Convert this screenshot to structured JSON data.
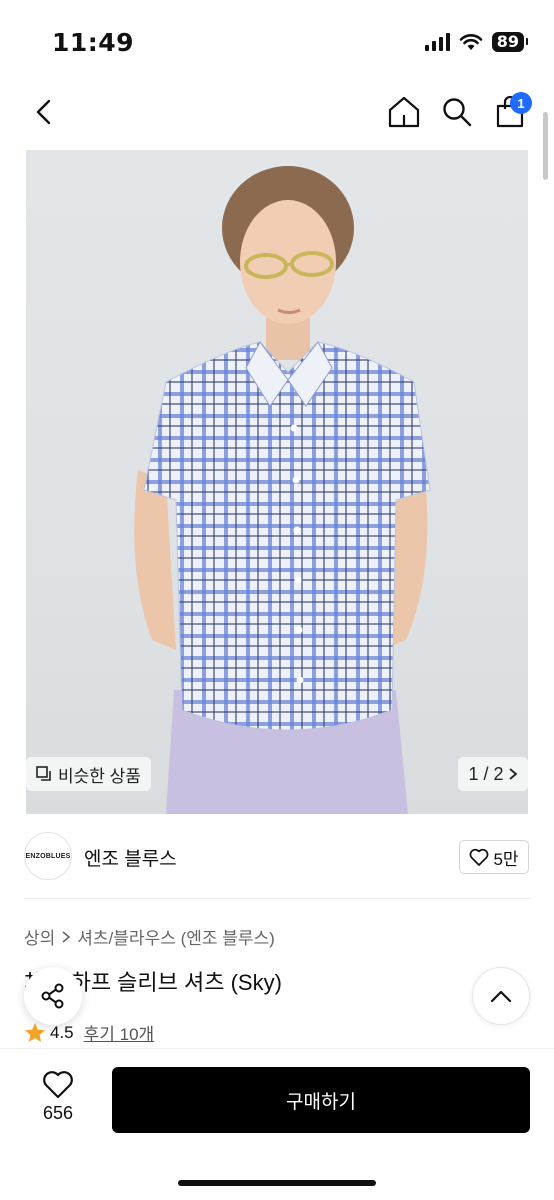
{
  "status_bar": {
    "time": "11:49",
    "battery_level": "89",
    "icons": [
      "signal-icon",
      "wifi-icon",
      "battery-icon"
    ]
  },
  "nav": {
    "icons": [
      "back-icon",
      "home-icon",
      "search-icon",
      "shopping-bag-icon"
    ],
    "cart_badge": "1",
    "badge_color": "#1f6bff"
  },
  "gallery": {
    "similar_label": "비슷한 상품",
    "page_current": "1",
    "page_total": "2",
    "page_indicator": "1 / 2"
  },
  "brand": {
    "logo_text": "ENZOBLUES",
    "name": "엔조 블루스",
    "like_count": "5만"
  },
  "breadcrumb": {
    "category": "상의",
    "subcategory": "셔츠/블라우스 (엔조 블루스)"
  },
  "product": {
    "title": "체크 하프 슬리브 셔츠 (Sky)",
    "rating": "4.5",
    "review_label": "후기 10개"
  },
  "bottom_bar": {
    "wish_count": "656",
    "buy_label": "구매하기",
    "buy_color": "#000000"
  }
}
